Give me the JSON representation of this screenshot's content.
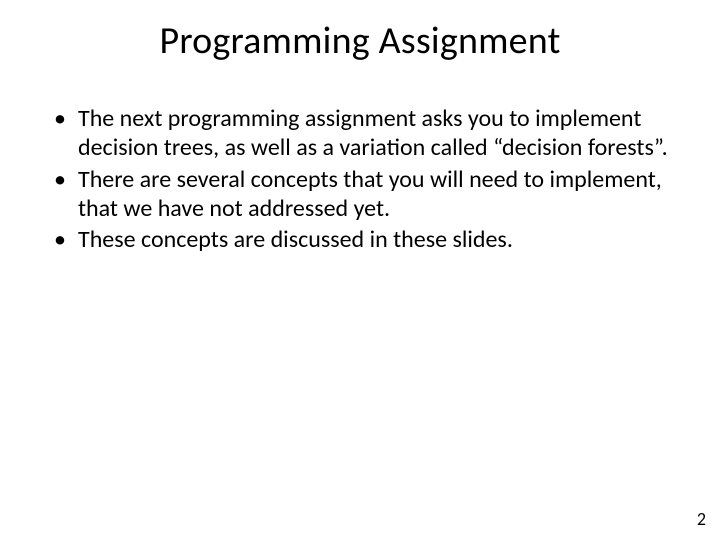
{
  "slide": {
    "title": "Programming Assignment",
    "bullets": [
      "The next programming assignment asks you to implement decision trees, as well as a variation called “decision forests”.",
      "There are several concepts that you will need to implement, that we have not addressed yet.",
      "These concepts are discussed in these slides."
    ],
    "page_number": "2"
  }
}
